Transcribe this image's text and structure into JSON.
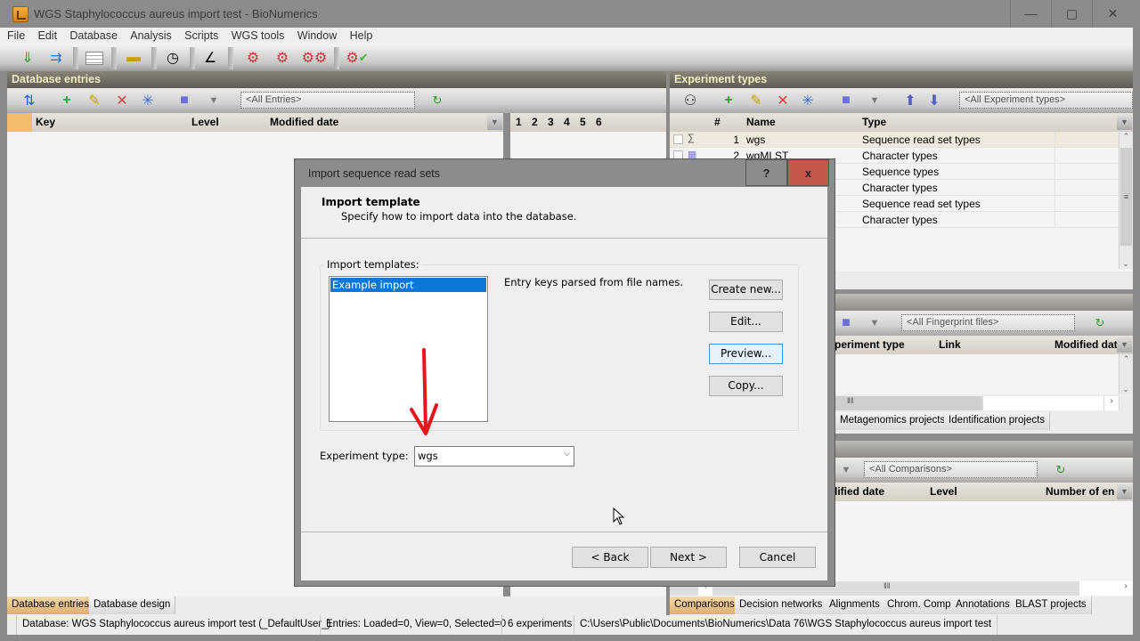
{
  "window": {
    "title": "WGS Staphylococcus aureus import test - BioNumerics",
    "minimize": "—",
    "maximize": "▢",
    "close": "✕"
  },
  "menu": [
    "File",
    "Edit",
    "Database",
    "Analysis",
    "Scripts",
    "WGS tools",
    "Window",
    "Help"
  ],
  "toolbar_icons": [
    "import-entries-icon",
    "import-arrow-icon",
    "spreadsheet-icon",
    "plugin-icon",
    "clock-icon",
    "curve-chart-icon",
    "gear-in-icon",
    "gear-out-icon",
    "gears-icon",
    "gear-check-icon"
  ],
  "db_entries": {
    "title": "Database entries",
    "filter": "<All Entries>",
    "columns": [
      "Key",
      "Level",
      "Modified date"
    ],
    "exp_numbers": [
      "1",
      "2",
      "3",
      "4",
      "5",
      "6"
    ],
    "tabs": [
      {
        "label": "Database entries",
        "active": true
      },
      {
        "label": "Database design",
        "active": false
      }
    ]
  },
  "experiment_types": {
    "title": "Experiment types",
    "filter": "<All Experiment types>",
    "columns": [
      "#",
      "Name",
      "Type"
    ],
    "rows": [
      {
        "num": "1",
        "name": "wgs",
        "type": "Sequence read set types",
        "icon": "sequence-read-set-icon"
      },
      {
        "num": "2",
        "name": "wgMLST",
        "type": "Character types",
        "icon": "character-type-icon"
      },
      {
        "num": "",
        "name": "",
        "type": "Sequence types",
        "icon": ""
      },
      {
        "num": "",
        "name": "",
        "type": "Character types",
        "icon": ""
      },
      {
        "num": "",
        "name": "",
        "type": "Sequence read set types",
        "icon": ""
      },
      {
        "num": "",
        "name": "",
        "type": "Character types",
        "icon": ""
      }
    ]
  },
  "fingerprint_files": {
    "filter": "<All Fingerprint files>",
    "columns": [
      "periment type",
      "Link",
      "Modified dat"
    ],
    "tabs": [
      {
        "label": "Metagenomics projects"
      },
      {
        "label": "Identification projects"
      }
    ]
  },
  "comparisons": {
    "filter": "<All Comparisons>",
    "columns": [
      "lified date",
      "Level",
      "Number of en"
    ],
    "tabs": [
      {
        "label": "Comparisons",
        "active": true
      },
      {
        "label": "Decision networks"
      },
      {
        "label": "Alignments"
      },
      {
        "label": "Chrom. Comp."
      },
      {
        "label": "Annotations"
      },
      {
        "label": "BLAST projects"
      }
    ]
  },
  "statusbar": {
    "database": "Database: WGS Staphylococcus aureus import test (_DefaultUser_)",
    "entries": "Entries: Loaded=0, View=0, Selected=0",
    "experiments": "6 experiments",
    "path": "C:\\Users\\Public\\Documents\\BioNumerics\\Data 76\\WGS Staphylococcus aureus import test"
  },
  "dialog": {
    "title": "Import sequence read sets",
    "help": "?",
    "close": "x",
    "heading": "Import template",
    "subheading": "Specify how to import data into the database.",
    "templates_label": "Import templates:",
    "templates": [
      {
        "label": "Example import",
        "selected": true
      }
    ],
    "description": "Entry keys parsed from file names.",
    "buttons": {
      "create": "Create new...",
      "edit": "Edit...",
      "preview": "Preview...",
      "copy": "Copy..."
    },
    "experiment_type_label": "Experiment type:",
    "experiment_type_value": "wgs",
    "back": "< Back",
    "next": "Next >",
    "cancel": "Cancel"
  },
  "annotation_color": "#e8141b"
}
